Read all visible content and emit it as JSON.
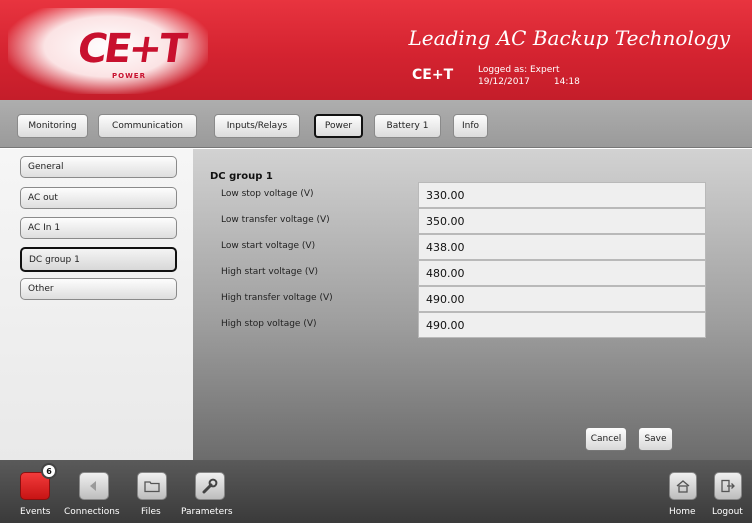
{
  "header": {
    "logo_text": "CE+T",
    "logo_sub": "POWER",
    "tagline": "Leading AC Backup Technology",
    "brand": "CE+T",
    "logged_as": "Logged as: Expert",
    "date": "19/12/2017",
    "time": "14:18",
    "accent_color": "#d42330"
  },
  "tabs": [
    {
      "label": "Monitoring",
      "active": false
    },
    {
      "label": "Communication",
      "active": false
    },
    {
      "label": "Inputs/Relays",
      "active": false
    },
    {
      "label": "Power",
      "active": true
    },
    {
      "label": "Battery 1",
      "active": false
    },
    {
      "label": "Info",
      "active": false
    }
  ],
  "sidebar": {
    "items": [
      {
        "label": "General",
        "active": false
      },
      {
        "label": "AC out",
        "active": false
      },
      {
        "label": "AC In 1",
        "active": false
      },
      {
        "label": "DC group 1",
        "active": true
      },
      {
        "label": "Other",
        "active": false
      }
    ]
  },
  "main": {
    "section_title": "DC group 1",
    "rows": [
      {
        "label": "Low stop voltage (V)",
        "value": "330.00"
      },
      {
        "label": "Low transfer voltage (V)",
        "value": "350.00"
      },
      {
        "label": "Low start voltage (V)",
        "value": "438.00"
      },
      {
        "label": "High start voltage (V)",
        "value": "480.00"
      },
      {
        "label": "High transfer voltage (V)",
        "value": "490.00"
      },
      {
        "label": "High stop voltage (V)",
        "value": "490.00"
      }
    ],
    "cancel_label": "Cancel",
    "save_label": "Save"
  },
  "bottom": {
    "events_label": "Events",
    "events_count": "6",
    "connections_label": "Connections",
    "files_label": "Files",
    "parameters_label": "Parameters",
    "home_label": "Home",
    "logout_label": "Logout",
    "icons": [
      "events-icon",
      "connections-icon",
      "folder-icon",
      "wrench-icon",
      "home-icon",
      "logout-icon"
    ]
  }
}
